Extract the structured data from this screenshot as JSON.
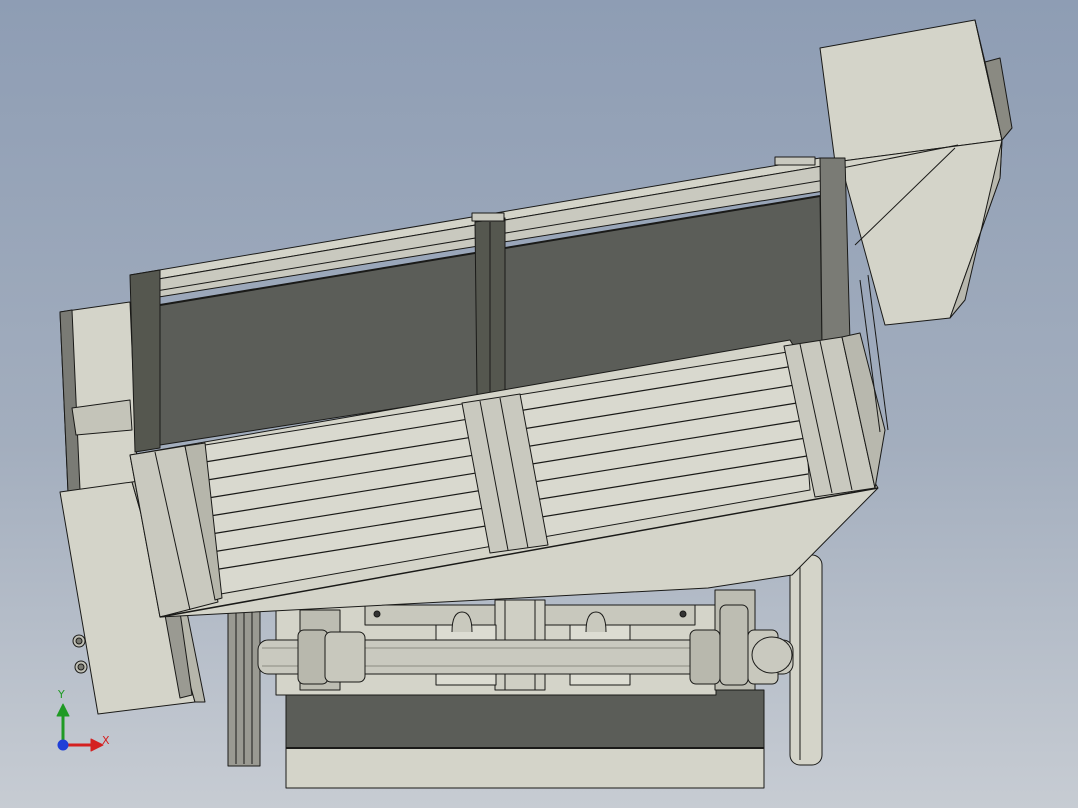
{
  "viewport": {
    "background_top": "#8e9db4",
    "background_bottom": "#c7ccd3"
  },
  "model": {
    "body_color": "#d4d4c9",
    "dark_panel_color": "#5b5d58",
    "edge_color": "#1a1a18"
  },
  "triad": {
    "x_label": "X",
    "y_label": "Y",
    "x_color": "#d42020",
    "y_color": "#1f9a24",
    "z_color": "#1f3fd8"
  }
}
